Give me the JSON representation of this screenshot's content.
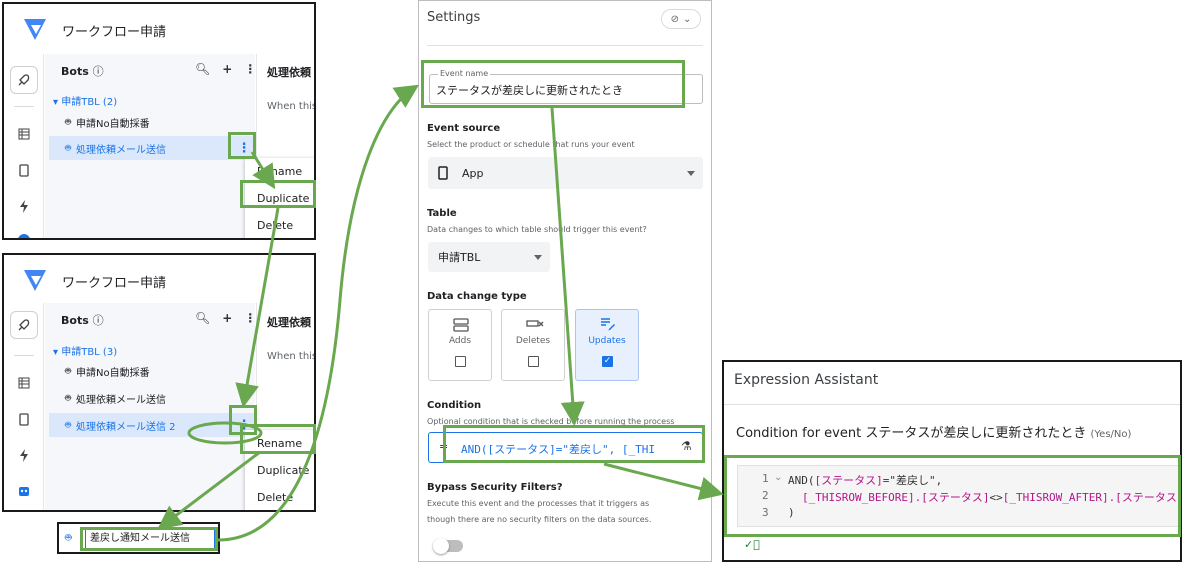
{
  "panel_top": {
    "app_title": "ワークフロー申請",
    "bots_header": "Bots",
    "table_group": "申請TBL (2)",
    "items": [
      "申請No自動採番",
      "処理依頼メール送信"
    ],
    "right_title": "処理依頼",
    "right_sub": "When this",
    "menu": [
      "Rename",
      "Duplicate",
      "Delete"
    ]
  },
  "panel_mid": {
    "app_title": "ワークフロー申請",
    "bots_header": "Bots",
    "table_group": "申請TBL (3)",
    "items": [
      "申請No自動採番",
      "処理依頼メール送信",
      "処理依頼メール送信 2"
    ],
    "right_title": "処理依頼",
    "right_sub": "When this",
    "menu": [
      "Rename",
      "Duplicate",
      "Delete"
    ]
  },
  "rename_input": "差戻し通知メール送信",
  "settings": {
    "heading": "Settings",
    "event_name_label": "Event name",
    "event_name_value": "ステータスが差戻しに更新されたとき",
    "event_source_label": "Event source",
    "event_source_help": "Select the product or schedule that runs your event",
    "event_source_value": "App",
    "table_label": "Table",
    "table_help": "Data changes to which table should trigger this event?",
    "table_value": "申請TBL",
    "dc_label": "Data change type",
    "dc_options": [
      {
        "label": "Adds",
        "checked": false
      },
      {
        "label": "Deletes",
        "checked": false
      },
      {
        "label": "Updates",
        "checked": true
      }
    ],
    "condition_label": "Condition",
    "condition_help": "Optional condition that is checked before running the process",
    "condition_prefix": "=",
    "condition_value": "AND([ステータス]=\"差戻し\", [_THI",
    "bypass_label": "Bypass Security Filters?",
    "bypass_help_1": "Execute this event and the processes that it triggers as",
    "bypass_help_2": "though there are no security filters on the data sources."
  },
  "expression": {
    "title": "Expression Assistant",
    "subtitle": "Condition for event ステータスが差戻しに更新されたとき",
    "subtitle_hint": "(Yes/No)",
    "line_numbers": [
      "1",
      "2",
      "3"
    ],
    "line1_a": "AND(",
    "line1_b": "[ステータス]",
    "line1_c": "=\"差戻し\",",
    "line2_a": "[_THISROW_BEFORE].[ステータス]",
    "line2_b": "<>",
    "line2_c": "[_THISROW_AFTER].[ステータス]",
    "line3": ")"
  },
  "colors": {
    "highlight": "#6aa84f",
    "accent": "#1a73e8",
    "code_column": "#b5168c"
  }
}
